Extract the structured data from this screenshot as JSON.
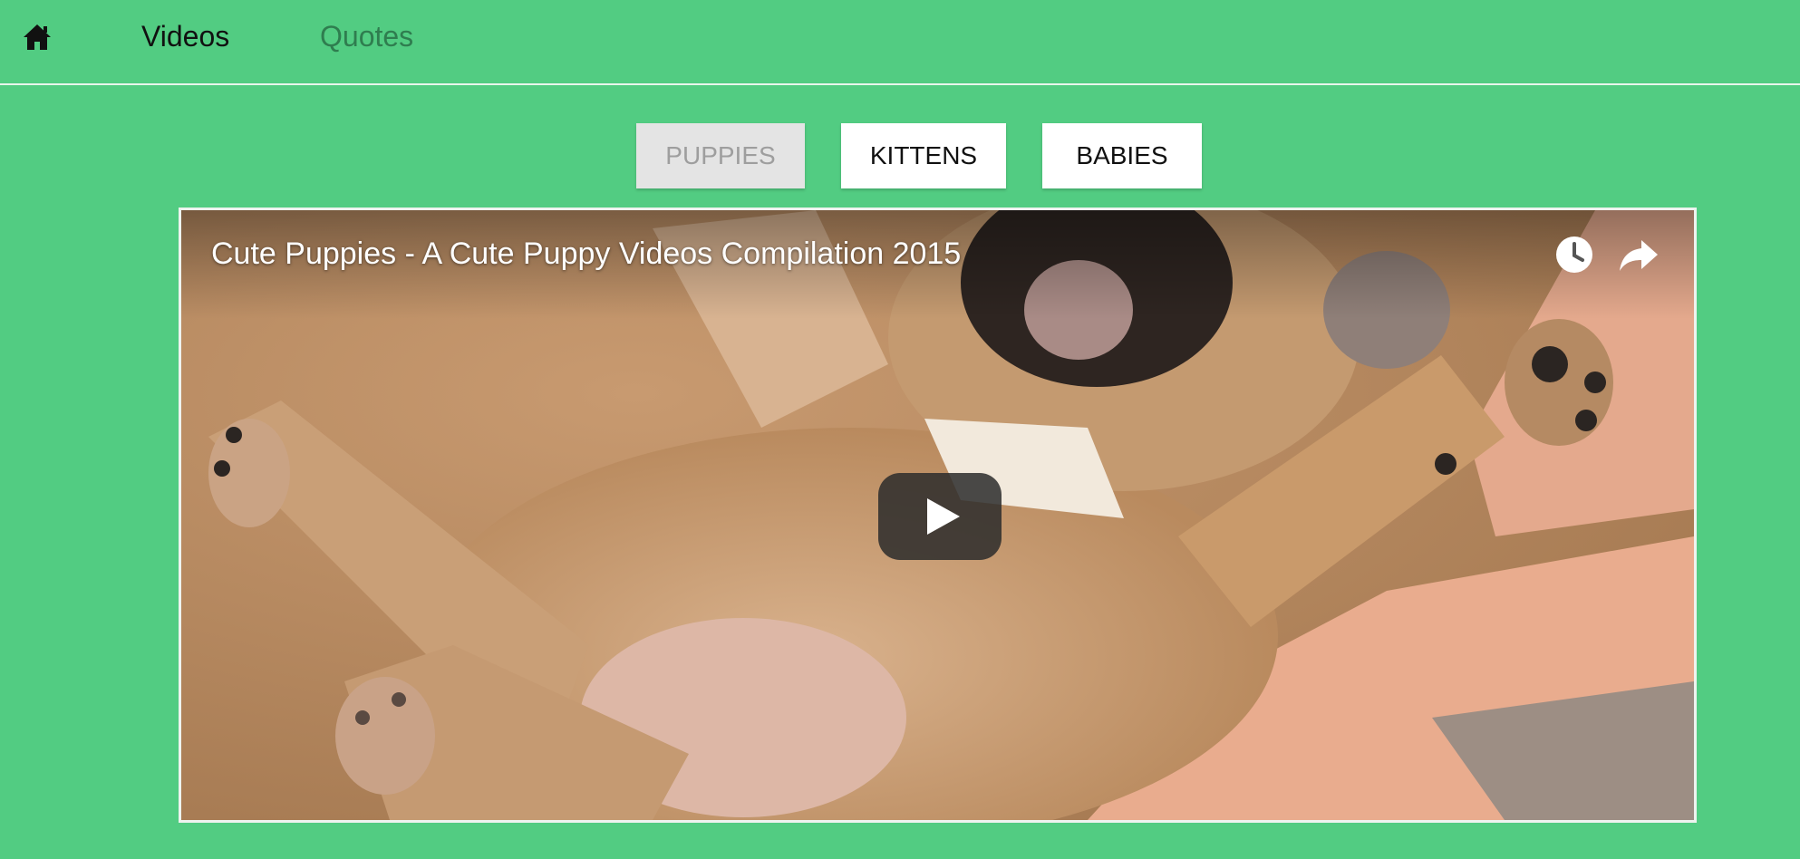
{
  "nav": {
    "home_icon": "home-icon",
    "items": [
      {
        "label": "Videos"
      },
      {
        "label": "Quotes"
      }
    ]
  },
  "categories": [
    {
      "label": "PUPPIES",
      "active": true
    },
    {
      "label": "KITTENS",
      "active": false
    },
    {
      "label": "BABIES",
      "active": false
    }
  ],
  "video": {
    "title": "Cute Puppies - A Cute Puppy Videos Compilation 2015",
    "icons": [
      "watch-later-icon",
      "share-icon",
      "play-icon"
    ]
  },
  "colors": {
    "background": "#52cc82",
    "active_button": "#e4e4e4",
    "button": "#ffffff"
  }
}
